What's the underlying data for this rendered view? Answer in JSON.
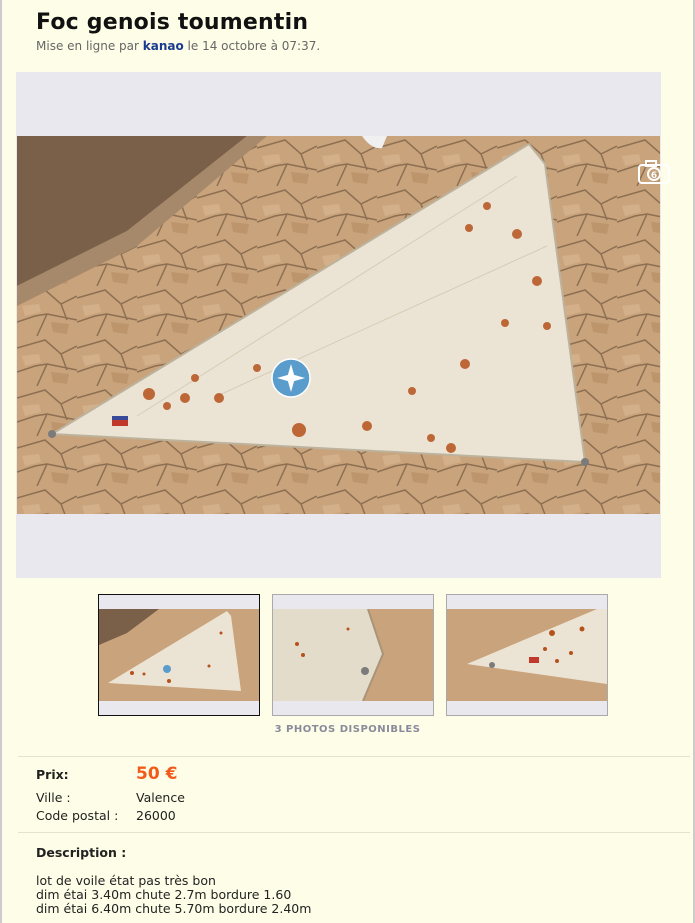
{
  "ad": {
    "title": "Foc genois toumentin",
    "meta_prefix": "Mise en ligne par ",
    "author": "kanao",
    "meta_suffix": " le 14 octobre à 07:37."
  },
  "gallery": {
    "photos_count_label": "3 PHOTOS DISPONIBLES",
    "camera_badge": "6"
  },
  "details": {
    "price_label": "Prix:",
    "price_value": "50 €",
    "city_label": "Ville :",
    "city_value": "Valence",
    "postal_label": "Code postal :",
    "postal_value": "26000"
  },
  "description": {
    "label": "Description :",
    "lines": [
      "lot de voile état pas très bon",
      "dim étai 3.40m chute 2.7m bordure 1.60",
      "dim étai 6.40m chute 5.70m bordure 2.40m"
    ]
  },
  "colors": {
    "background": "#fefee8",
    "price": "#f25a1a",
    "author_link": "#1a3c8f"
  }
}
